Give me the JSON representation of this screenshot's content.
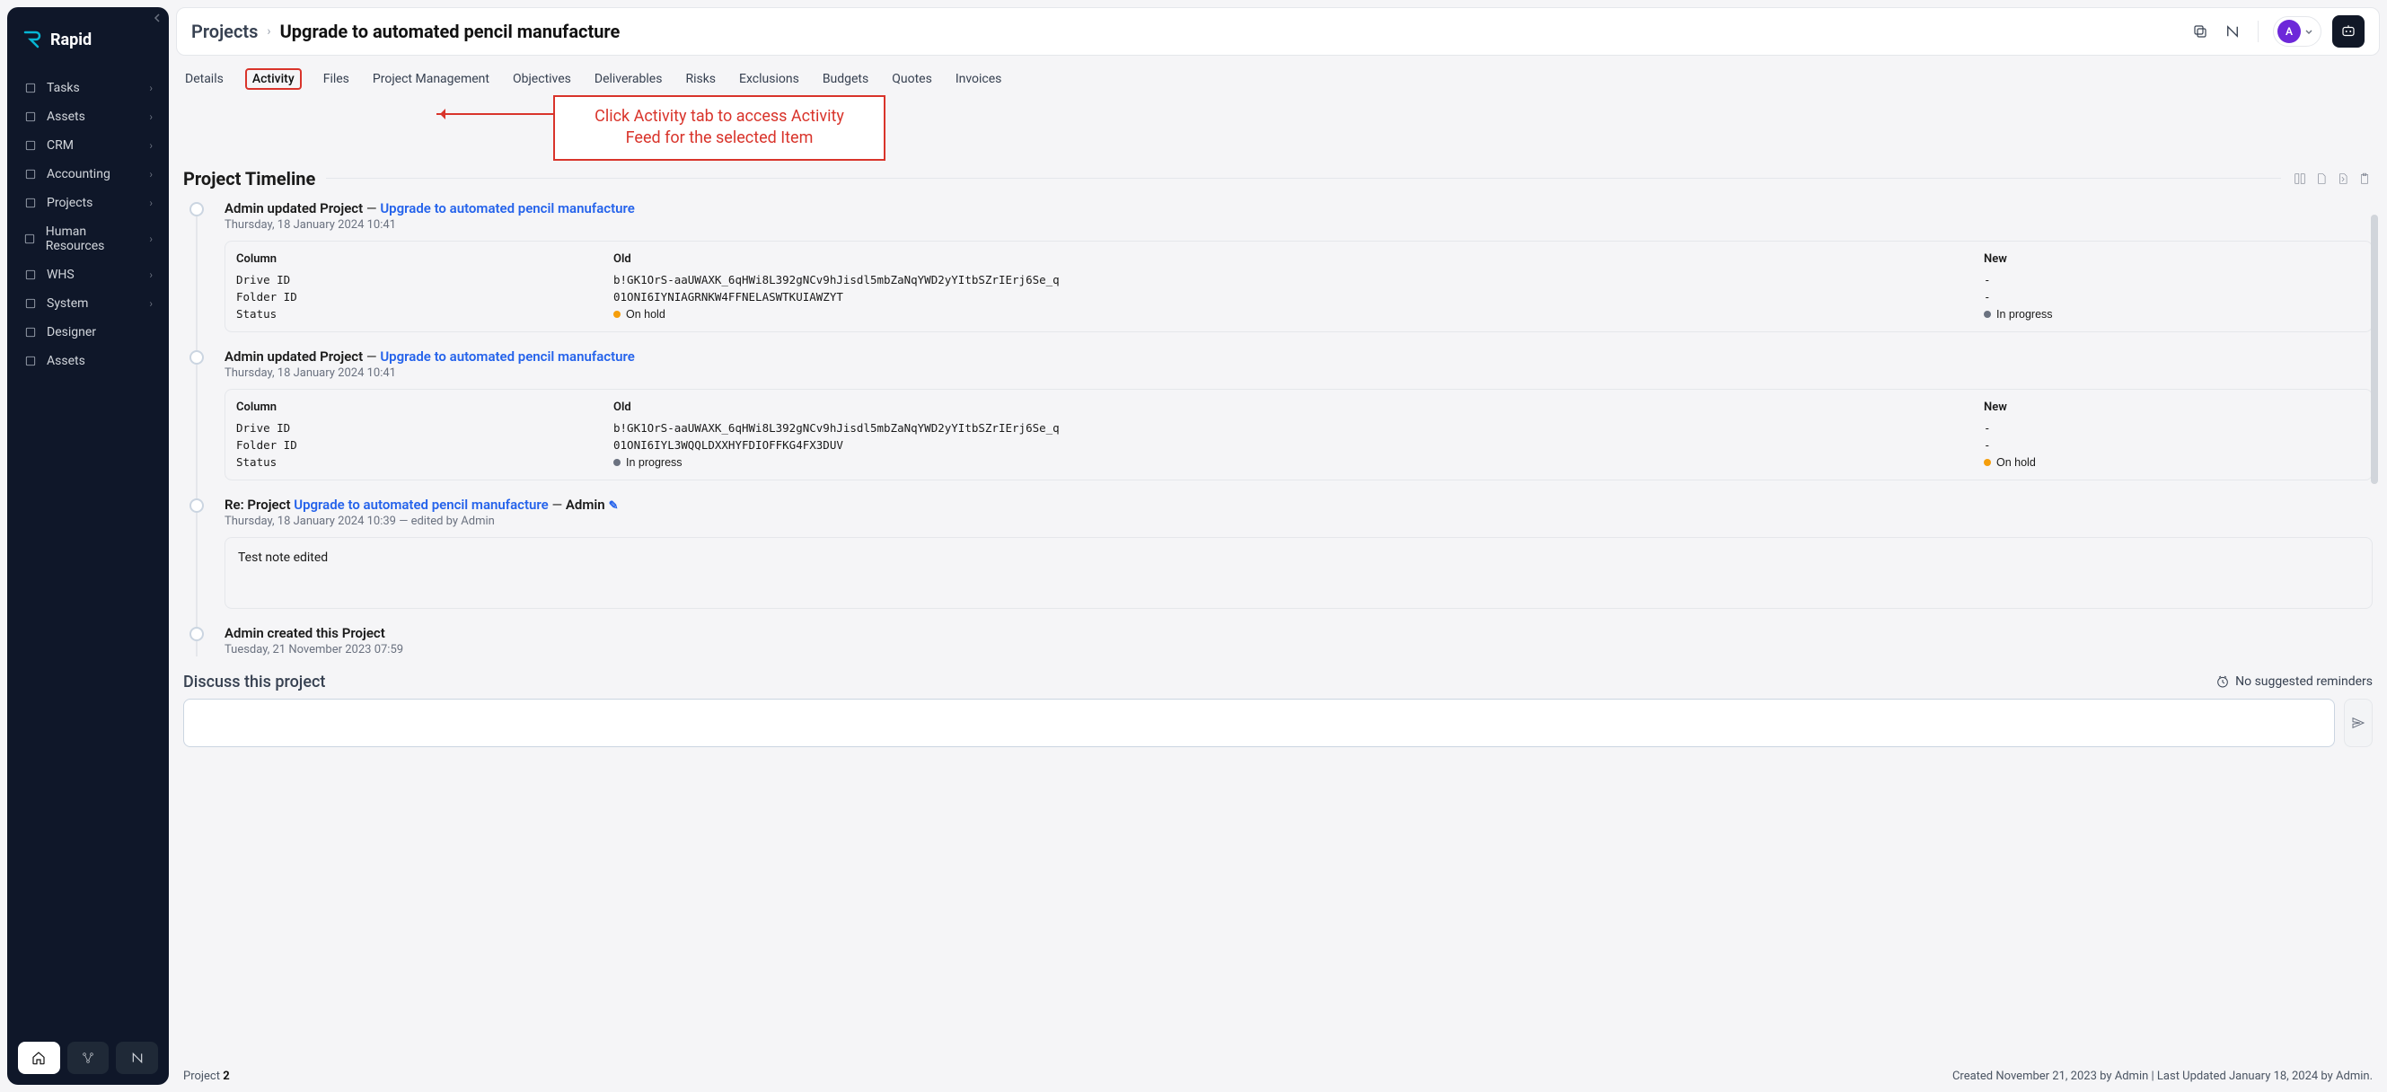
{
  "brand": {
    "name": "Rapid"
  },
  "sidebar": {
    "items": [
      {
        "label": "Tasks",
        "icon": "clipboard-check-icon",
        "expandable": true
      },
      {
        "label": "Assets",
        "icon": "cube-icon",
        "expandable": true
      },
      {
        "label": "CRM",
        "icon": "user-icon",
        "expandable": true
      },
      {
        "label": "Accounting",
        "icon": "currency-icon",
        "expandable": true
      },
      {
        "label": "Projects",
        "icon": "folder-open-icon",
        "expandable": true
      },
      {
        "label": "Human Resources",
        "icon": "users-icon",
        "expandable": true
      },
      {
        "label": "WHS",
        "icon": "heart-icon",
        "expandable": true
      },
      {
        "label": "System",
        "icon": "server-icon",
        "expandable": true
      },
      {
        "label": "Designer",
        "icon": "layout-icon",
        "expandable": false
      },
      {
        "label": "Assets",
        "icon": "archive-icon",
        "expandable": false
      }
    ]
  },
  "breadcrumb": {
    "root": "Projects",
    "current": "Upgrade to automated pencil manufacture"
  },
  "avatar_initial": "A",
  "tabs": [
    "Details",
    "Activity",
    "Files",
    "Project Management",
    "Objectives",
    "Deliverables",
    "Risks",
    "Exclusions",
    "Budgets",
    "Quotes",
    "Invoices"
  ],
  "active_tab": "Activity",
  "annotation": {
    "line1": "Click Activity tab to access Activity",
    "line2": "Feed for the selected Item"
  },
  "section_title": "Project Timeline",
  "timeline": [
    {
      "actor": "Admin",
      "verb": "updated",
      "entity": "Project",
      "link": "Upgrade to automated pencil manufacture",
      "date": "Thursday, 18 January 2024",
      "time": "10:41",
      "changes_header": {
        "col": "Column",
        "old": "Old",
        "new": "New"
      },
      "changes": [
        {
          "col": "Drive ID",
          "old": "b!GK1OrS-aaUWAXK_6qHWi8L392gNCv9hJisdl5mbZaNqYWD2yYItbSZrIErj6Se_q",
          "new": "-"
        },
        {
          "col": "Folder ID",
          "old": "01ONI6IYNIAGRNKW4FFNELASWTKUIAWZYT",
          "new": "-"
        },
        {
          "col": "Status",
          "old": "On hold",
          "old_dot": "orange",
          "new": "In progress",
          "new_dot": "gray"
        }
      ]
    },
    {
      "actor": "Admin",
      "verb": "updated",
      "entity": "Project",
      "link": "Upgrade to automated pencil manufacture",
      "date": "Thursday, 18 January 2024",
      "time": "10:41",
      "changes_header": {
        "col": "Column",
        "old": "Old",
        "new": "New"
      },
      "changes": [
        {
          "col": "Drive ID",
          "old": "b!GK1OrS-aaUWAXK_6qHWi8L392gNCv9hJisdl5mbZaNqYWD2yYItbSZrIErj6Se_q",
          "new": "-"
        },
        {
          "col": "Folder ID",
          "old": "01ONI6IYL3WQQLDXXHYFDIOFFKG4FX3DUV",
          "new": "-"
        },
        {
          "col": "Status",
          "old": "In progress",
          "old_dot": "gray",
          "new": "On hold",
          "new_dot": "orange"
        }
      ]
    },
    {
      "prefix": "Re:",
      "entity": "Project",
      "link": "Upgrade to automated pencil manufacture",
      "actor": "Admin",
      "editable": true,
      "date": "Thursday, 18 January 2024",
      "time": "10:39",
      "suffix": "— edited by Admin",
      "note": "Test note edited"
    },
    {
      "actor": "Admin",
      "verb": "created this",
      "entity": "Project",
      "date": "Tuesday, 21 November 2023",
      "time": "07:59"
    }
  ],
  "discuss": {
    "title": "Discuss this project",
    "reminders": "No suggested reminders"
  },
  "footer": {
    "label": "Project",
    "id": "2",
    "meta": "Created November 21, 2023 by Admin | Last Updated January 18, 2024 by Admin."
  }
}
